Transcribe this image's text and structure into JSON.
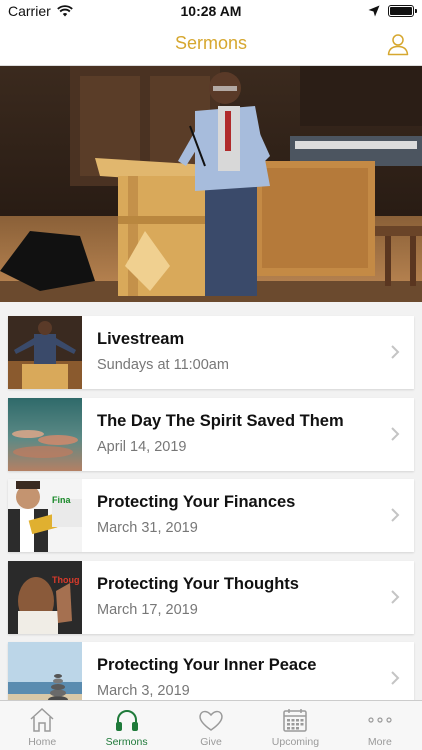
{
  "status": {
    "carrier": "Carrier",
    "time": "10:28 AM"
  },
  "nav": {
    "title": "Sermons"
  },
  "sermons": [
    {
      "title": "Livestream",
      "subtitle": "Sundays at 11:00am"
    },
    {
      "title": "The Day The Spirit Saved Them",
      "subtitle": "April 14, 2019"
    },
    {
      "title": "Protecting Your Finances",
      "subtitle": "March 31, 2019",
      "thumb_text": "Fina"
    },
    {
      "title": "Protecting Your Thoughts",
      "subtitle": "March 17, 2019",
      "thumb_text": "Thoug"
    },
    {
      "title": "Protecting Your Inner Peace",
      "subtitle": "March 3, 2019"
    }
  ],
  "tabs": [
    {
      "label": "Home",
      "icon": "home-icon"
    },
    {
      "label": "Sermons",
      "icon": "headphones-icon"
    },
    {
      "label": "Give",
      "icon": "heart-icon"
    },
    {
      "label": "Upcoming",
      "icon": "calendar-icon"
    },
    {
      "label": "More",
      "icon": "more-icon"
    }
  ],
  "colors": {
    "accent": "#d6a72f",
    "active_tab": "#1f7a3a",
    "inactive_tab": "#9a9a9a"
  }
}
